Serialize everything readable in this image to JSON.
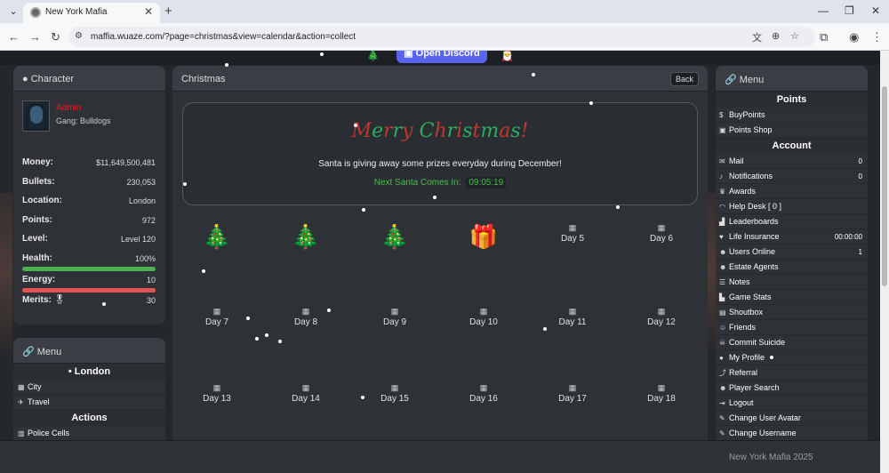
{
  "browser": {
    "tab_title": "New York Mafia",
    "url": "maffia.wuaze.com/?page=christmas&view=calendar&action=collect"
  },
  "top": {
    "discord_label": "Open Discord"
  },
  "character": {
    "title": "Character",
    "name": "Admin",
    "gang": "Gang: Bulldogs",
    "stats": [
      {
        "label": "Money:",
        "value": "$11,649,500,481"
      },
      {
        "label": "Bullets:",
        "value": "230,053"
      },
      {
        "label": "Location:",
        "value": "London"
      },
      {
        "label": "Points:",
        "value": "972"
      },
      {
        "label": "Level:",
        "value": "Level 120"
      },
      {
        "label": "Health:",
        "value": "100%"
      },
      {
        "label": "Energy:",
        "value": "10"
      },
      {
        "label": "Merits:",
        "value": "30"
      }
    ],
    "health_fraction": 1.0,
    "energy_fraction": 1.0,
    "health_color": "#4caf50",
    "energy_color": "#e25555"
  },
  "left_menu": {
    "title": "Menu",
    "location_heading": "• London",
    "items": [
      "City",
      "Travel"
    ],
    "actions_heading": "Actions",
    "action_items": [
      "Police Cells"
    ]
  },
  "christmas": {
    "title": "Christmas",
    "back_label": "Back",
    "greeting": "Merry Christmas!",
    "message": "Santa is giving away some prizes everyday during December!",
    "next_label": "Next Santa Comes In:",
    "timer": "09:05:19",
    "days": [
      {
        "label": "",
        "icon": "christmas-tree"
      },
      {
        "label": "",
        "icon": "christmas-tree"
      },
      {
        "label": "",
        "icon": "christmas-tree"
      },
      {
        "label": "",
        "icon": "gift"
      },
      {
        "label": "Day 5",
        "icon": "calendar"
      },
      {
        "label": "Day 6",
        "icon": "calendar"
      },
      {
        "label": "Day 7",
        "icon": "calendar"
      },
      {
        "label": "Day 8",
        "icon": "calendar"
      },
      {
        "label": "Day 9",
        "icon": "calendar"
      },
      {
        "label": "Day 10",
        "icon": "calendar"
      },
      {
        "label": "Day 11",
        "icon": "calendar"
      },
      {
        "label": "Day 12",
        "icon": "calendar"
      },
      {
        "label": "Day 13",
        "icon": "calendar"
      },
      {
        "label": "Day 14",
        "icon": "calendar"
      },
      {
        "label": "Day 15",
        "icon": "calendar"
      },
      {
        "label": "Day 16",
        "icon": "calendar"
      },
      {
        "label": "Day 17",
        "icon": "calendar"
      },
      {
        "label": "Day 18",
        "icon": "calendar"
      }
    ]
  },
  "right_menu": {
    "title": "Menu",
    "points_heading": "Points",
    "points_items": [
      {
        "label": "BuyPoints",
        "icon": "dollar-icon"
      },
      {
        "label": "Points Shop",
        "icon": "bag-icon"
      }
    ],
    "account_heading": "Account",
    "account_items": [
      {
        "label": "Mail",
        "badge": "0",
        "icon": "mail-icon"
      },
      {
        "label": "Notifications",
        "badge": "0",
        "icon": "bell-icon"
      },
      {
        "label": "Awards",
        "badge": "",
        "icon": "trophy-icon"
      },
      {
        "label": "Help Desk [ 0 ]",
        "badge": "",
        "icon": "headset-icon"
      },
      {
        "label": "Leaderboards",
        "badge": "",
        "icon": "chart-icon"
      },
      {
        "label": "Life Insurance",
        "badge": "00:00:00",
        "icon": "heart-icon"
      },
      {
        "label": "Users Online",
        "badge": "1",
        "icon": "users-icon"
      },
      {
        "label": "Estate Agents",
        "badge": "",
        "icon": "people-icon"
      },
      {
        "label": "Notes",
        "badge": "",
        "icon": "note-icon"
      },
      {
        "label": "Game Stats",
        "badge": "",
        "icon": "stats-icon"
      },
      {
        "label": "Shoutbox",
        "badge": "",
        "icon": "chat-icon"
      },
      {
        "label": "Friends",
        "badge": "",
        "icon": "friends-icon"
      },
      {
        "label": "Commit Suicide",
        "badge": "",
        "icon": "skull-icon"
      },
      {
        "label": "My Profile",
        "badge": "",
        "icon": "user-icon"
      },
      {
        "label": "Referral",
        "badge": "",
        "icon": "share-icon"
      },
      {
        "label": "Player Search",
        "badge": "",
        "icon": "search-icon"
      },
      {
        "label": "Logout",
        "badge": "",
        "icon": "logout-icon"
      },
      {
        "label": "Change User Avatar",
        "badge": "",
        "icon": "edit-icon"
      },
      {
        "label": "Change Username",
        "badge": "",
        "icon": "edit-icon"
      }
    ]
  },
  "footer": {
    "text": "New York Mafia 2025"
  },
  "colors": {
    "merry_red": "#c0392b",
    "merry_green": "#27ae60",
    "timer_green": "#43c043",
    "admin_red": "#e02020",
    "discord_blue": "#5865f2"
  }
}
